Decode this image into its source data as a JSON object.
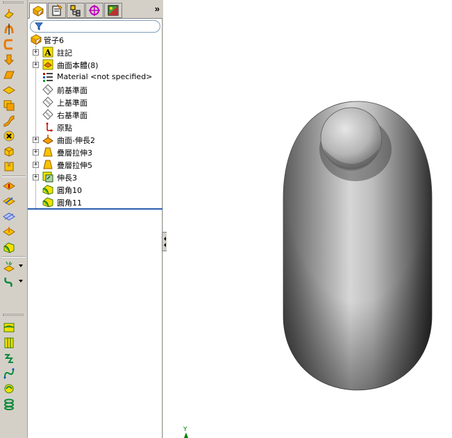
{
  "panel": {
    "more_label": "»",
    "tabs": [
      {
        "icon": "feature-manager-icon"
      },
      {
        "icon": "property-manager-icon"
      },
      {
        "icon": "configuration-manager-icon"
      },
      {
        "icon": "dimxpert-icon"
      },
      {
        "icon": "display-manager-icon"
      }
    ]
  },
  "tree": {
    "root_label": "管子6",
    "items": [
      {
        "label": "註記",
        "icon": "annotations-icon",
        "expandable": true
      },
      {
        "label": "曲面本體(8)",
        "icon": "surface-bodies-icon",
        "expandable": true
      },
      {
        "label": "Material <not specified>",
        "icon": "material-icon",
        "expandable": false
      },
      {
        "label": "前基準面",
        "icon": "plane-icon",
        "expandable": false
      },
      {
        "label": "上基準面",
        "icon": "plane-icon",
        "expandable": false
      },
      {
        "label": "右基準面",
        "icon": "plane-icon",
        "expandable": false
      },
      {
        "label": "原點",
        "icon": "origin-icon",
        "expandable": false
      },
      {
        "label": "曲面-伸長2",
        "icon": "surface-extrude-icon",
        "expandable": true
      },
      {
        "label": "疊層拉伸3",
        "icon": "loft-icon",
        "expandable": true
      },
      {
        "label": "疊層拉伸5",
        "icon": "loft-icon",
        "expandable": true
      },
      {
        "label": "伸長3",
        "icon": "extend-icon",
        "expandable": true
      },
      {
        "label": "圓角10",
        "icon": "fillet-icon",
        "expandable": false
      },
      {
        "label": "圓角11",
        "icon": "fillet-icon",
        "expandable": false
      }
    ]
  },
  "viewport": {
    "axis_label": "Y"
  },
  "colors": {
    "toolbar_bg": "#d4d0c8",
    "rollback_bar": "#2a5fb0",
    "axis_green": "#008000",
    "icon_yellow": "#f5c400",
    "icon_orange": "#e87a00"
  }
}
